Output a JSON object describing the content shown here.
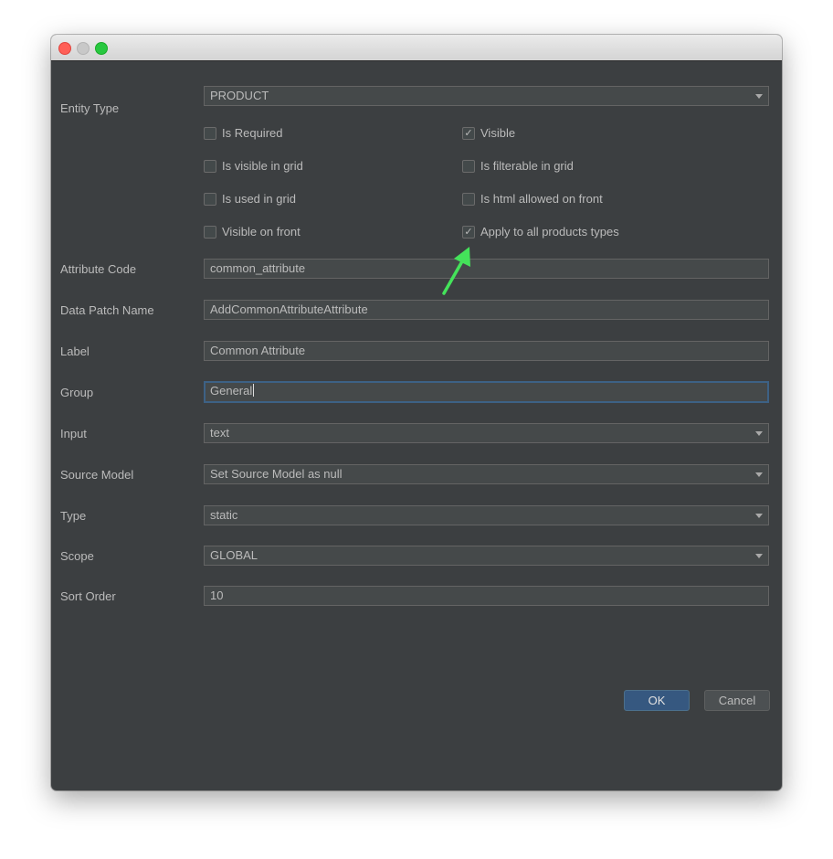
{
  "form": {
    "entity_type": {
      "label": "Entity Type",
      "value": "PRODUCT"
    },
    "checkboxes": [
      {
        "label": "Is Required",
        "checked": false
      },
      {
        "label": "Visible",
        "checked": true
      },
      {
        "label": "Is visible in grid",
        "checked": false
      },
      {
        "label": "Is filterable in grid",
        "checked": false
      },
      {
        "label": "Is used in grid",
        "checked": false
      },
      {
        "label": "Is html allowed on front",
        "checked": false
      },
      {
        "label": "Visible on front",
        "checked": false
      },
      {
        "label": "Apply to all products types",
        "checked": true
      }
    ],
    "attribute_code": {
      "label": "Attribute Code",
      "value": "common_attribute"
    },
    "data_patch_name": {
      "label": "Data Patch Name",
      "value": "AddCommonAttributeAttribute"
    },
    "label_field": {
      "label": "Label",
      "value": "Common Attribute"
    },
    "group": {
      "label": "Group",
      "value": "General"
    },
    "input": {
      "label": "Input",
      "value": "text"
    },
    "source_model": {
      "label": "Source Model",
      "value": "Set Source Model as null"
    },
    "type": {
      "label": "Type",
      "value": "static"
    },
    "scope": {
      "label": "Scope",
      "value": "GLOBAL"
    },
    "sort_order": {
      "label": "Sort Order",
      "value": "10"
    }
  },
  "buttons": {
    "ok": "OK",
    "cancel": "Cancel"
  },
  "check_glyph": "✓",
  "colors": {
    "annotation_arrow": "#44e35a",
    "ok_button": "#365880",
    "dialog_bg": "#3c3f41"
  }
}
